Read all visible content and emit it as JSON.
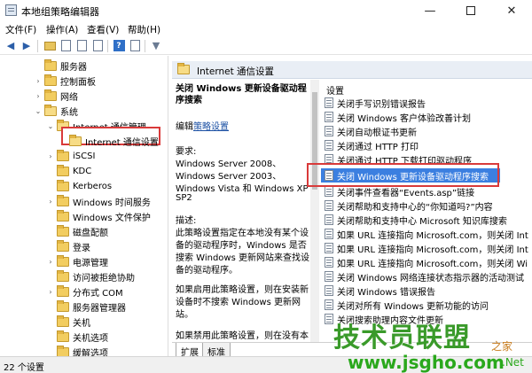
{
  "window": {
    "title": "本地组策略编辑器",
    "min": "—",
    "max": "",
    "close": "✕"
  },
  "menu": [
    "文件(F)",
    "操作(A)",
    "查看(V)",
    "帮助(H)"
  ],
  "tree": [
    {
      "label": "服务器",
      "exp": ""
    },
    {
      "label": "控制面板",
      "exp": "›"
    },
    {
      "label": "网络",
      "exp": "›"
    },
    {
      "label": "系统",
      "exp": "⌄"
    },
    {
      "label": "Internet 通信管理",
      "exp": "⌄"
    },
    {
      "label": "Internet 通信设置",
      "exp": ""
    },
    {
      "label": "iSCSI",
      "exp": "›"
    },
    {
      "label": "KDC",
      "exp": ""
    },
    {
      "label": "Kerberos",
      "exp": ""
    },
    {
      "label": "Windows 时间服务",
      "exp": "›"
    },
    {
      "label": "Windows 文件保护",
      "exp": ""
    },
    {
      "label": "磁盘配额",
      "exp": ""
    },
    {
      "label": "登录",
      "exp": ""
    },
    {
      "label": "电源管理",
      "exp": "›"
    },
    {
      "label": "访问被拒绝协助",
      "exp": ""
    },
    {
      "label": "分布式 COM",
      "exp": "›"
    },
    {
      "label": "服务器管理器",
      "exp": ""
    },
    {
      "label": "关机",
      "exp": ""
    },
    {
      "label": "关机选项",
      "exp": ""
    },
    {
      "label": "缓解选项",
      "exp": ""
    }
  ],
  "header": {
    "title": "Internet 通信设置"
  },
  "description": {
    "title": "关闭 Windows 更新设备驱动程序搜索",
    "edit_prefix": "编辑",
    "edit_link": "策略设置",
    "lines": [
      "要求:",
      "Windows Server 2008、",
      "Windows Server 2003、",
      "Windows Vista 和 Windows XP",
      "SP2",
      "",
      "描述:",
      "此策略设置指定在本地没有某个设",
      "备的驱动程序时，Windows 是否",
      "搜索 Windows 更新网站来查找设",
      "备的驱动程序。",
      "",
      "如果启用此策略设置，则在安装新",
      "设备时不搜索 Windows 更新网",
      "站。",
      "",
      "如果禁用此策略设置，则在没有本"
    ]
  },
  "list": {
    "header": "设置",
    "items": [
      "关闭手写识别错误报告",
      "关闭 Windows 客户体验改善计划",
      "关闭自动根证书更新",
      "关闭通过 HTTP 打印",
      "关闭通过 HTTP 下载打印驱动程序",
      "关闭 Windows 更新设备驱动程序搜索",
      "关闭事件查看器“Events.asp”链接",
      "关闭帮助和支持中心的“你知道吗?”内容",
      "关闭帮助和支持中心 Microsoft 知识库搜索",
      "如果 URL 连接指向 Microsoft.com，则关闭 Int",
      "如果 URL 连接指向 Microsoft.com，则关闭 Int",
      "如果 URL 连接指向 Microsoft.com，则关闭 Wi",
      "关闭 Windows 网络连接状态指示器的活动测试",
      "关闭 Windows 错误报告",
      "关闭对所有 Windows 更新功能的访问",
      "关闭搜索助理内容文件更新"
    ],
    "selected_index": 5
  },
  "tabs": [
    "扩展",
    "标准"
  ],
  "status": {
    "text": "22 个设置"
  },
  "watermark": {
    "logo": "技术员联盟",
    "right": "之家",
    "url": "www.jsgho.com",
    "net": ".Net"
  }
}
